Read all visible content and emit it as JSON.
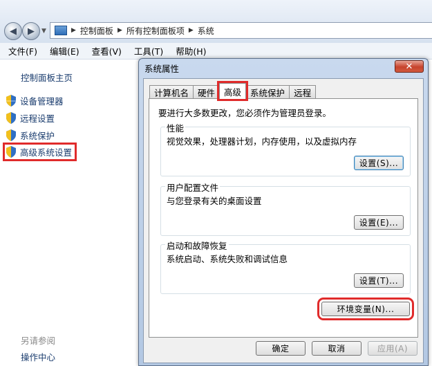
{
  "breadcrumb": [
    "控制面板",
    "所有控制面板项",
    "系统"
  ],
  "menu": [
    "文件(F)",
    "编辑(E)",
    "查看(V)",
    "工具(T)",
    "帮助(H)"
  ],
  "left_pane": {
    "home": "控制面板主页",
    "items": [
      "设备管理器",
      "远程设置",
      "系统保护",
      "高级系统设置"
    ],
    "see_also": "另请参阅",
    "action_center": "操作中心"
  },
  "dialog": {
    "title": "系统属性",
    "close": "✕",
    "tabs": [
      "计算机名",
      "硬件",
      "高级",
      "系统保护",
      "远程"
    ],
    "notice": "要进行大多数更改，您必须作为管理员登录。",
    "performance": {
      "legend": "性能",
      "desc": "视觉效果，处理器计划，内存使用，以及虚拟内存",
      "button": "设置(S)..."
    },
    "profile": {
      "legend": "用户配置文件",
      "desc": "与您登录有关的桌面设置",
      "button": "设置(E)..."
    },
    "startup": {
      "legend": "启动和故障恢复",
      "desc": "系统启动、系统失败和调试信息",
      "button": "设置(T)..."
    },
    "env_button": "环境变量(N)...",
    "ok": "确定",
    "cancel": "取消",
    "apply": "应用(A)"
  },
  "colors": {
    "highlight": "#e02b2b",
    "link": "#1a3c6e"
  }
}
